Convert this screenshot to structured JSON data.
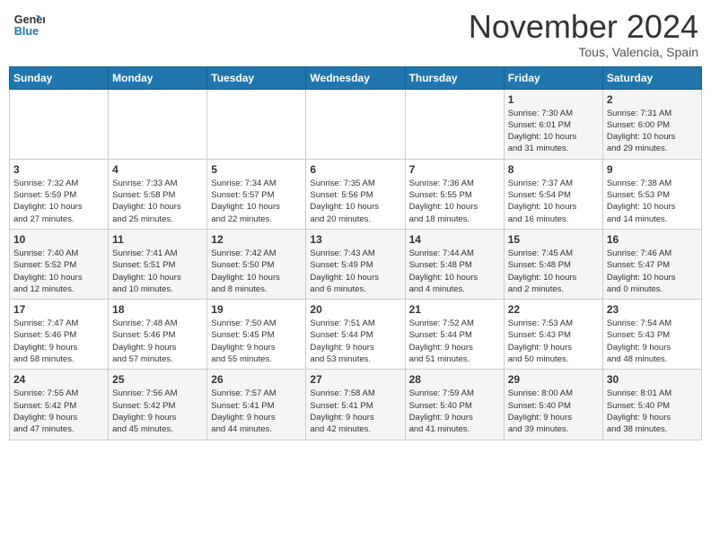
{
  "header": {
    "logo_line1": "General",
    "logo_line2": "Blue",
    "month": "November 2024",
    "location": "Tous, Valencia, Spain"
  },
  "weekdays": [
    "Sunday",
    "Monday",
    "Tuesday",
    "Wednesday",
    "Thursday",
    "Friday",
    "Saturday"
  ],
  "weeks": [
    [
      {
        "day": "",
        "info": ""
      },
      {
        "day": "",
        "info": ""
      },
      {
        "day": "",
        "info": ""
      },
      {
        "day": "",
        "info": ""
      },
      {
        "day": "",
        "info": ""
      },
      {
        "day": "1",
        "info": "Sunrise: 7:30 AM\nSunset: 6:01 PM\nDaylight: 10 hours\nand 31 minutes."
      },
      {
        "day": "2",
        "info": "Sunrise: 7:31 AM\nSunset: 6:00 PM\nDaylight: 10 hours\nand 29 minutes."
      }
    ],
    [
      {
        "day": "3",
        "info": "Sunrise: 7:32 AM\nSunset: 5:59 PM\nDaylight: 10 hours\nand 27 minutes."
      },
      {
        "day": "4",
        "info": "Sunrise: 7:33 AM\nSunset: 5:58 PM\nDaylight: 10 hours\nand 25 minutes."
      },
      {
        "day": "5",
        "info": "Sunrise: 7:34 AM\nSunset: 5:57 PM\nDaylight: 10 hours\nand 22 minutes."
      },
      {
        "day": "6",
        "info": "Sunrise: 7:35 AM\nSunset: 5:56 PM\nDaylight: 10 hours\nand 20 minutes."
      },
      {
        "day": "7",
        "info": "Sunrise: 7:36 AM\nSunset: 5:55 PM\nDaylight: 10 hours\nand 18 minutes."
      },
      {
        "day": "8",
        "info": "Sunrise: 7:37 AM\nSunset: 5:54 PM\nDaylight: 10 hours\nand 16 minutes."
      },
      {
        "day": "9",
        "info": "Sunrise: 7:38 AM\nSunset: 5:53 PM\nDaylight: 10 hours\nand 14 minutes."
      }
    ],
    [
      {
        "day": "10",
        "info": "Sunrise: 7:40 AM\nSunset: 5:52 PM\nDaylight: 10 hours\nand 12 minutes."
      },
      {
        "day": "11",
        "info": "Sunrise: 7:41 AM\nSunset: 5:51 PM\nDaylight: 10 hours\nand 10 minutes."
      },
      {
        "day": "12",
        "info": "Sunrise: 7:42 AM\nSunset: 5:50 PM\nDaylight: 10 hours\nand 8 minutes."
      },
      {
        "day": "13",
        "info": "Sunrise: 7:43 AM\nSunset: 5:49 PM\nDaylight: 10 hours\nand 6 minutes."
      },
      {
        "day": "14",
        "info": "Sunrise: 7:44 AM\nSunset: 5:48 PM\nDaylight: 10 hours\nand 4 minutes."
      },
      {
        "day": "15",
        "info": "Sunrise: 7:45 AM\nSunset: 5:48 PM\nDaylight: 10 hours\nand 2 minutes."
      },
      {
        "day": "16",
        "info": "Sunrise: 7:46 AM\nSunset: 5:47 PM\nDaylight: 10 hours\nand 0 minutes."
      }
    ],
    [
      {
        "day": "17",
        "info": "Sunrise: 7:47 AM\nSunset: 5:46 PM\nDaylight: 9 hours\nand 58 minutes."
      },
      {
        "day": "18",
        "info": "Sunrise: 7:48 AM\nSunset: 5:46 PM\nDaylight: 9 hours\nand 57 minutes."
      },
      {
        "day": "19",
        "info": "Sunrise: 7:50 AM\nSunset: 5:45 PM\nDaylight: 9 hours\nand 55 minutes."
      },
      {
        "day": "20",
        "info": "Sunrise: 7:51 AM\nSunset: 5:44 PM\nDaylight: 9 hours\nand 53 minutes."
      },
      {
        "day": "21",
        "info": "Sunrise: 7:52 AM\nSunset: 5:44 PM\nDaylight: 9 hours\nand 51 minutes."
      },
      {
        "day": "22",
        "info": "Sunrise: 7:53 AM\nSunset: 5:43 PM\nDaylight: 9 hours\nand 50 minutes."
      },
      {
        "day": "23",
        "info": "Sunrise: 7:54 AM\nSunset: 5:43 PM\nDaylight: 9 hours\nand 48 minutes."
      }
    ],
    [
      {
        "day": "24",
        "info": "Sunrise: 7:55 AM\nSunset: 5:42 PM\nDaylight: 9 hours\nand 47 minutes."
      },
      {
        "day": "25",
        "info": "Sunrise: 7:56 AM\nSunset: 5:42 PM\nDaylight: 9 hours\nand 45 minutes."
      },
      {
        "day": "26",
        "info": "Sunrise: 7:57 AM\nSunset: 5:41 PM\nDaylight: 9 hours\nand 44 minutes."
      },
      {
        "day": "27",
        "info": "Sunrise: 7:58 AM\nSunset: 5:41 PM\nDaylight: 9 hours\nand 42 minutes."
      },
      {
        "day": "28",
        "info": "Sunrise: 7:59 AM\nSunset: 5:40 PM\nDaylight: 9 hours\nand 41 minutes."
      },
      {
        "day": "29",
        "info": "Sunrise: 8:00 AM\nSunset: 5:40 PM\nDaylight: 9 hours\nand 39 minutes."
      },
      {
        "day": "30",
        "info": "Sunrise: 8:01 AM\nSunset: 5:40 PM\nDaylight: 9 hours\nand 38 minutes."
      }
    ]
  ]
}
